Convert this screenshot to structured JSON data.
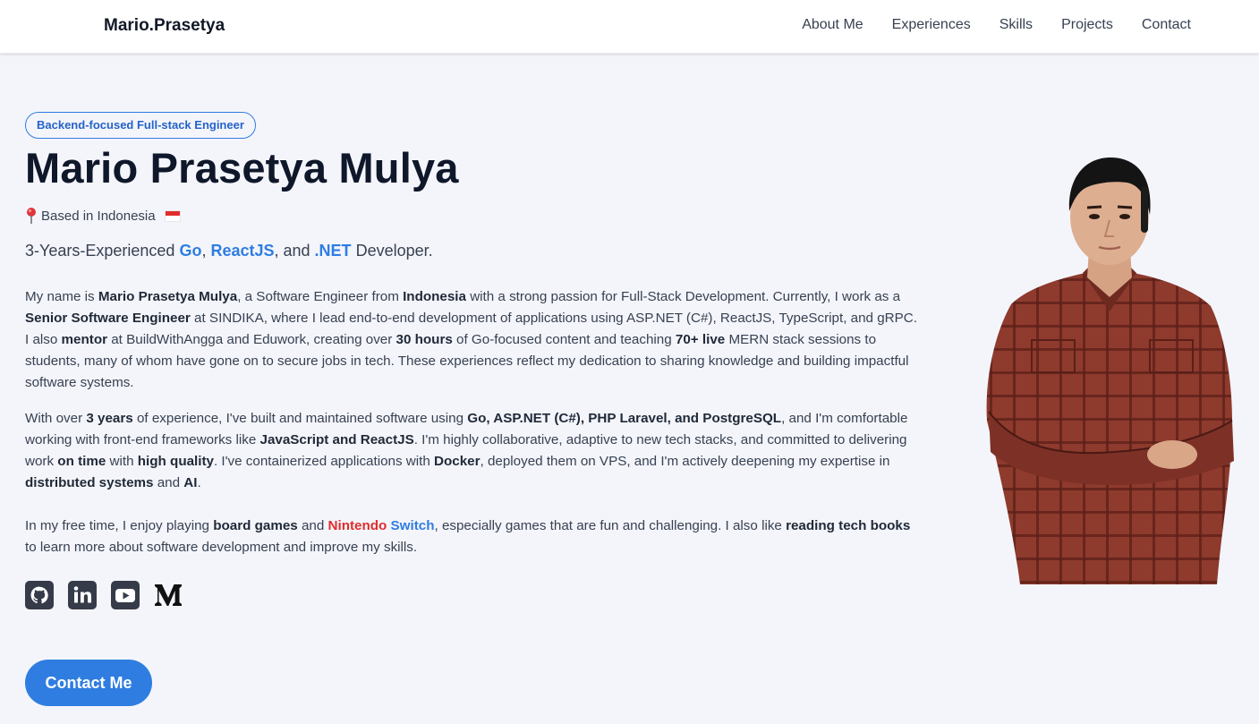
{
  "nav": {
    "brand": "Mario.Prasetya",
    "links": [
      "About Me",
      "Experiences",
      "Skills",
      "Projects",
      "Contact"
    ]
  },
  "hero": {
    "badge": "Backend-focused Full-stack Engineer",
    "name": "Mario Prasetya Mulya",
    "location": "Based in Indonesia",
    "tagline": {
      "prefix": "3-Years-Experienced ",
      "tech1": "Go",
      "sep1": ", ",
      "tech2": "ReactJS",
      "sep2": ", and ",
      "tech3": ".NET",
      "suffix": " Developer."
    }
  },
  "about": {
    "p1": [
      {
        "t": "My name is ",
        "b": false
      },
      {
        "t": "Mario Prasetya Mulya",
        "b": true
      },
      {
        "t": ", a Software Engineer from ",
        "b": false
      },
      {
        "t": "Indonesia",
        "b": true
      },
      {
        "t": " with a strong passion for Full-Stack Development. Currently, I work as a ",
        "b": false
      },
      {
        "t": "Senior Software Engineer",
        "b": true
      },
      {
        "t": " at SINDIKA, where I lead end-to-end development of applications using ASP.NET (C#), ReactJS, TypeScript, and gRPC. I also ",
        "b": false
      },
      {
        "t": "mentor",
        "b": true
      },
      {
        "t": " at BuildWithAngga and Eduwork, creating over ",
        "b": false
      },
      {
        "t": "30 hours",
        "b": true
      },
      {
        "t": " of Go-focused content and teaching ",
        "b": false
      },
      {
        "t": "70+ live",
        "b": true
      },
      {
        "t": " MERN stack sessions to students, many of whom have gone on to secure jobs in tech. These experiences reflect my dedication to sharing knowledge and building impactful software systems.",
        "b": false
      }
    ],
    "p2": [
      {
        "t": "With over ",
        "b": false
      },
      {
        "t": "3 years",
        "b": true
      },
      {
        "t": " of experience, I've built and maintained software using ",
        "b": false
      },
      {
        "t": "Go, ASP.NET (C#), PHP Laravel, and PostgreSQL",
        "b": true
      },
      {
        "t": ", and I'm comfortable working with front-end frameworks like ",
        "b": false
      },
      {
        "t": "JavaScript and ReactJS",
        "b": true
      },
      {
        "t": ". I'm highly collaborative, adaptive to new tech stacks, and committed to delivering work ",
        "b": false
      },
      {
        "t": "on time",
        "b": true
      },
      {
        "t": " with ",
        "b": false
      },
      {
        "t": "high quality",
        "b": true
      },
      {
        "t": ". I've containerized applications with ",
        "b": false
      },
      {
        "t": "Docker",
        "b": true
      },
      {
        "t": ", deployed them on VPS, and I'm actively deepening my expertise in ",
        "b": false
      },
      {
        "t": "distributed systems",
        "b": true
      },
      {
        "t": " and ",
        "b": false
      },
      {
        "t": "AI",
        "b": true
      },
      {
        "t": ".",
        "b": false
      }
    ],
    "p3": [
      {
        "t": "In my free time, I enjoy playing ",
        "b": false
      },
      {
        "t": "board games",
        "b": true
      },
      {
        "t": " and ",
        "b": false
      },
      {
        "t": "Nintendo",
        "b": "red"
      },
      {
        "t": " ",
        "b": false
      },
      {
        "t": "Switch",
        "b": "blue"
      },
      {
        "t": ", especially games that are fun and challenging. I also like ",
        "b": false
      },
      {
        "t": "reading tech books",
        "b": true
      },
      {
        "t": " to learn more about software development and improve my skills.",
        "b": false
      }
    ]
  },
  "socials": [
    {
      "icon": "github-icon"
    },
    {
      "icon": "linkedin-icon"
    },
    {
      "icon": "youtube-icon"
    },
    {
      "icon": "medium-icon"
    }
  ],
  "cta": {
    "label": "Contact Me"
  },
  "colors": {
    "accent": "#2f7de1",
    "nintendo_red": "#e02c2c",
    "background": "#f4f5fb",
    "heading": "#0f172a"
  }
}
